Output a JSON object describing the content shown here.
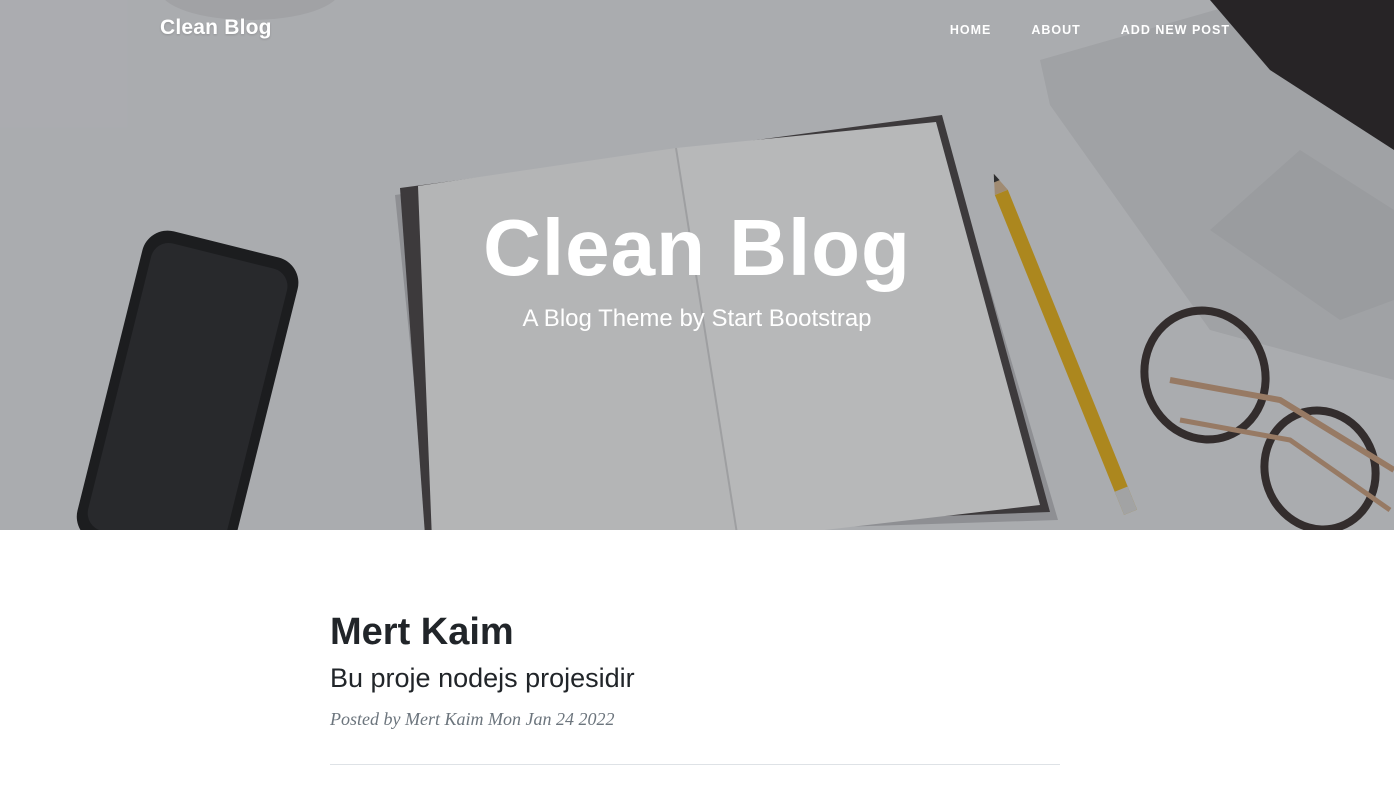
{
  "navbar": {
    "brand": "Clean Blog",
    "links": [
      {
        "label": "HOME"
      },
      {
        "label": "ABOUT"
      },
      {
        "label": "ADD NEW POST"
      }
    ]
  },
  "hero": {
    "title": "Clean Blog",
    "subtitle": "A Blog Theme by Start Bootstrap"
  },
  "posts": [
    {
      "title": "Mert Kaim",
      "subtitle": "Bu proje nodejs projesidir",
      "meta_prefix": "Posted by",
      "author": "Mert Kaim",
      "date": "Mon Jan 24 2022"
    }
  ],
  "colors": {
    "text_dark": "#212529",
    "text_muted": "#6c757d",
    "divider": "#dee2e6",
    "hero_overlay": "#212529"
  }
}
